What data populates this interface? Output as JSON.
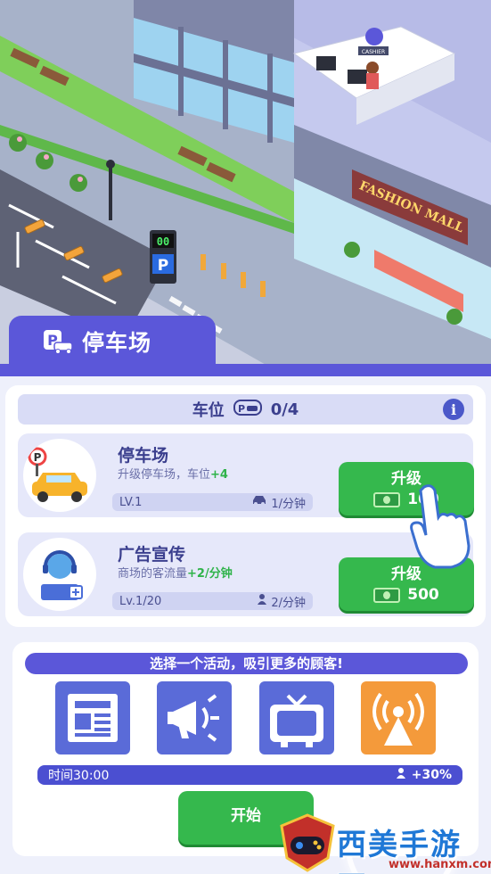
{
  "panel": {
    "title": "停车场",
    "icon": "parking-car-icon"
  },
  "slots": {
    "label": "车位",
    "value": "0/4",
    "icon": "parking-slot-icon",
    "info_icon": "info-icon",
    "info_glyph": "i"
  },
  "upgrades": [
    {
      "name": "停车场",
      "desc_prefix": "升级停车场，车位",
      "desc_bonus": "+4",
      "level": "LV.1",
      "rate": "1/分钟",
      "rate_icon": "car-icon",
      "button_label": "升级",
      "cost": "100",
      "avatar_icon": "parking-car-avatar-icon"
    },
    {
      "name": "广告宣传",
      "desc_prefix": "商场的客流量",
      "desc_bonus": "+2/分钟",
      "level": "Lv.1/20",
      "rate": "2/分钟",
      "rate_icon": "person-icon",
      "button_label": "升级",
      "cost": "500",
      "avatar_icon": "staff-headset-avatar-icon"
    }
  ],
  "activity": {
    "title": "选择一个活动，吸引更多的顾客!",
    "options": [
      "newspaper-icon",
      "megaphone-icon",
      "tv-icon",
      "radio-tower-icon"
    ],
    "time": "时间30:00",
    "bonus": "+30%",
    "start_label": "开始"
  },
  "watermark": {
    "text": "西美手游网",
    "url": "www.hanxm.com"
  },
  "scene": {
    "mall_sign": "FASHION MALL",
    "counter_sign": "CASHIER",
    "meter": "00",
    "parking_letter": "P"
  },
  "colors": {
    "primary": "#5b57d9",
    "green": "#35b84d",
    "orange": "#f49a3b",
    "bg": "#eef0fb"
  }
}
